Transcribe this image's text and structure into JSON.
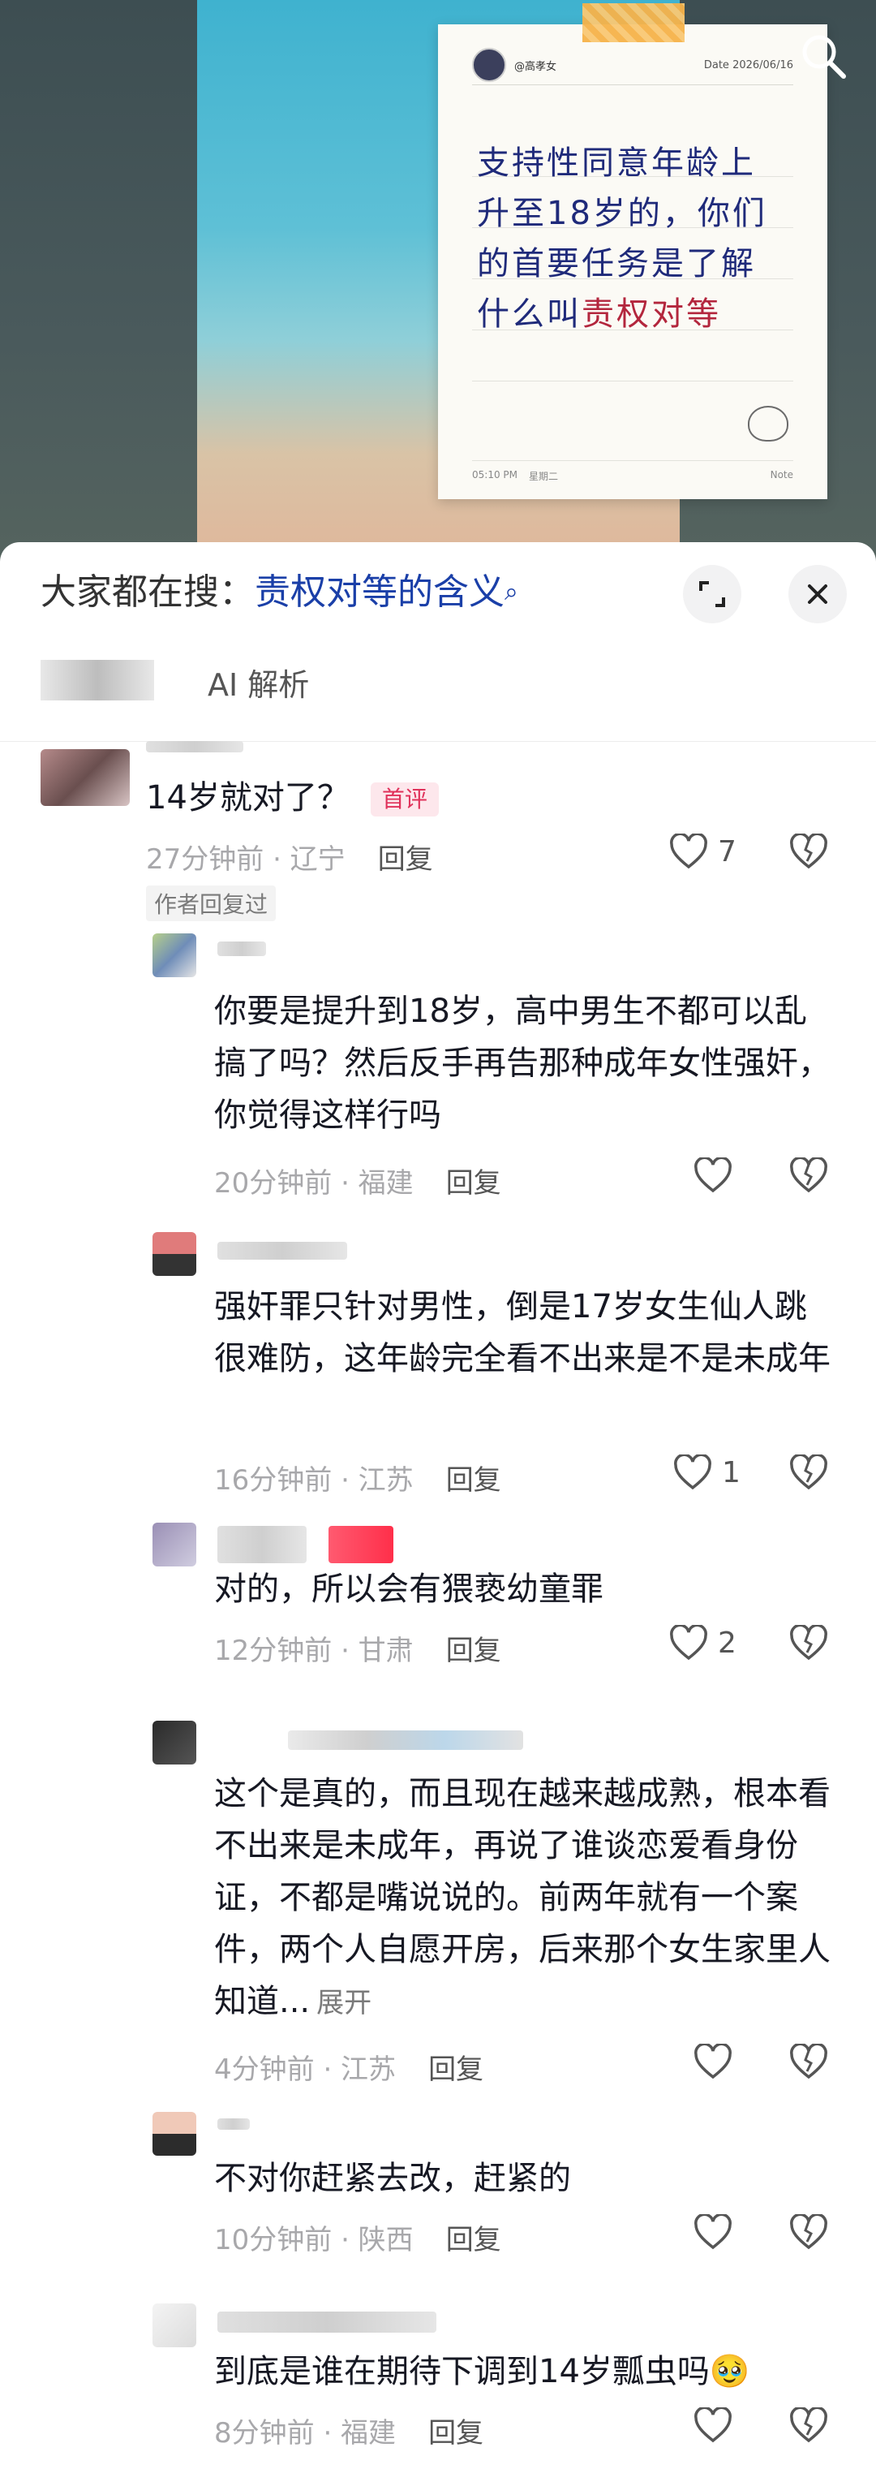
{
  "photo_note": {
    "author": "@高孝女",
    "date": "Date  2026/06/16",
    "lines": [
      "支持性同意年龄上",
      "升至18岁的，你们",
      "的首要任务是了解",
      "什么叫"
    ],
    "highlight": "责权对等",
    "time": "05:10 PM",
    "weekday": "星期二",
    "note_label": "Note"
  },
  "search_bar": {
    "prefix": "大家都在搜：",
    "query": "责权对等的含义",
    "query_icon": "search-icon"
  },
  "tabs": {
    "ai_label": "AI 解析"
  },
  "comments": [
    {
      "text": "14岁就对了？",
      "badge": "首评",
      "time": "27分钟前 · 辽宁",
      "reply": "回复",
      "likes": "7",
      "author_replied": "作者回复过"
    },
    {
      "text": "你要是提升到18岁，高中男生不都可以乱搞了吗？然后反手再告那种成年女性强奸，你觉得这样行吗",
      "time": "20分钟前 · 福建",
      "reply": "回复",
      "likes": ""
    },
    {
      "text": "强奸罪只针对男性，倒是17岁女生仙人跳很难防，这年龄完全看不出来是不是未成年",
      "time": "16分钟前 · 江苏",
      "reply": "回复",
      "likes": "1"
    },
    {
      "text": "对的，所以会有猥亵幼童罪",
      "time": "12分钟前 · 甘肃",
      "reply": "回复",
      "likes": "2"
    },
    {
      "text": "这个是真的，而且现在越来越成熟，根本看不出来是未成年，再说了谁谈恋爱看身份证，不都是嘴说说的。前两年就有一个案件，两个人自愿开房，后来那个女生家里人知道...",
      "more": "展开",
      "time": "4分钟前 · 江苏",
      "reply": "回复",
      "likes": ""
    },
    {
      "text": "不对你赶紧去改，赶紧的",
      "time": "10分钟前 · 陕西",
      "reply": "回复",
      "likes": ""
    },
    {
      "text": "到底是谁在期待下调到14岁瓢虫吗",
      "emoji": "🥹",
      "time": "8分钟前 · 福建",
      "reply": "回复",
      "likes": ""
    }
  ]
}
